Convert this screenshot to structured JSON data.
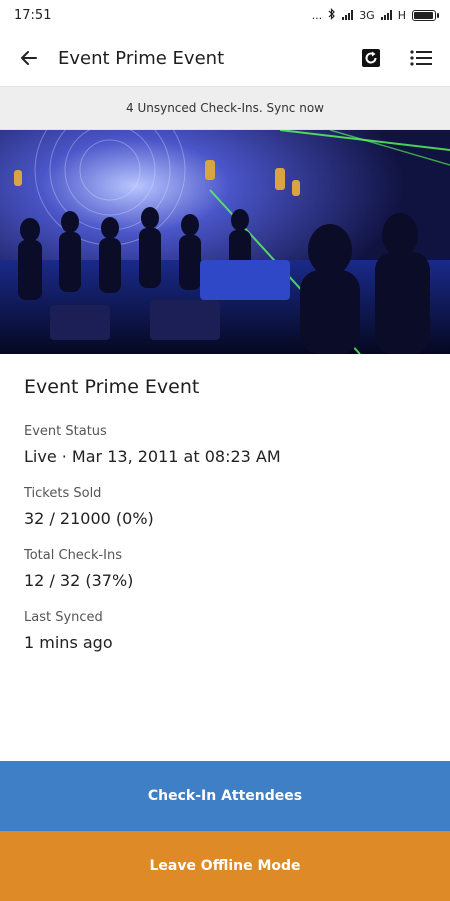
{
  "status_bar": {
    "time": "17:51",
    "dots": "...",
    "network": "3G",
    "network2": "H"
  },
  "app_bar": {
    "title": "Event Prime Event"
  },
  "banner": {
    "text": "4 Unsynced Check-Ins. Sync now"
  },
  "event": {
    "name": "Event Prime Event",
    "fields": [
      {
        "label": "Event Status",
        "value": "Live · Mar 13, 2011 at 08:23 AM"
      },
      {
        "label": "Tickets Sold",
        "value": "32 / 21000 (0%)"
      },
      {
        "label": "Total Check-Ins",
        "value": "12 / 32 (37%)"
      },
      {
        "label": "Last Synced",
        "value": "1 mins ago"
      }
    ]
  },
  "buttons": {
    "check_in": "Check-In Attendees",
    "leave_offline": "Leave Offline Mode"
  },
  "colors": {
    "primary_blue": "#3f7fc6",
    "accent_orange": "#de8a26",
    "banner_bg": "#eeeeee"
  }
}
